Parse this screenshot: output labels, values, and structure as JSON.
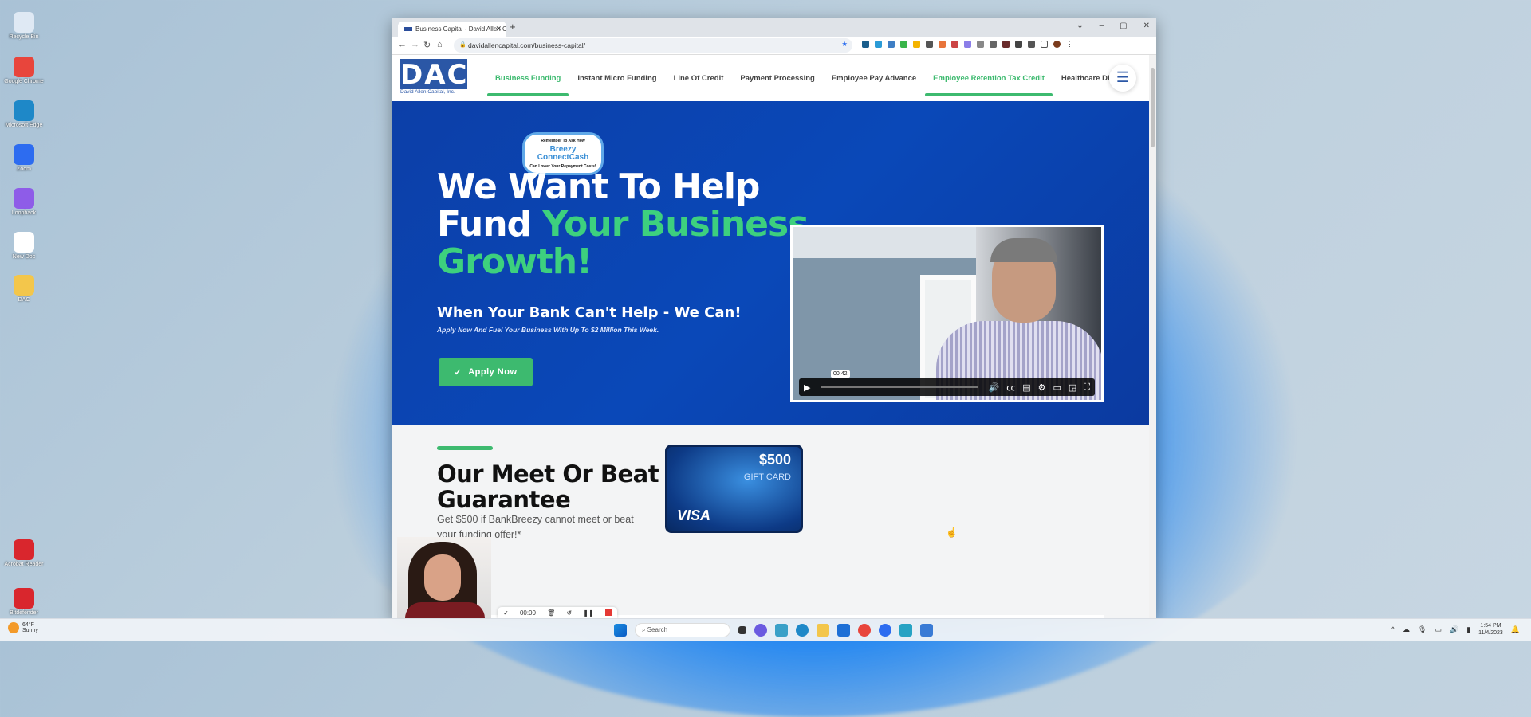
{
  "desktop": {
    "icons": [
      {
        "label": "Recycle Bin",
        "color": "#dfe9f4"
      },
      {
        "label": "Google Chrome",
        "color": "#e8453c"
      },
      {
        "label": "Microsoft Edge",
        "color": "#1e88c8"
      },
      {
        "label": "Zoom",
        "color": "#2d6cf0"
      },
      {
        "label": "Loopback",
        "color": "#8e5ce8"
      },
      {
        "label": "New Doc",
        "color": "#ffffff"
      },
      {
        "label": "DAC",
        "color": "#f3c64b"
      },
      {
        "label": "Acrobat Reader",
        "color": "#d9262d"
      },
      {
        "label": "Bitdefender",
        "color": "#d9262d"
      }
    ]
  },
  "browser": {
    "tab_title": "Business Capital - David Allen C",
    "new_tab": "+",
    "window_controls": [
      "⌄",
      "–",
      "▢",
      "✕"
    ],
    "url": "davidallencapital.com/business-capital/"
  },
  "site": {
    "logo_text": "DAC",
    "logo_sub": "David Allen Capital, Inc.",
    "nav": [
      {
        "label": "Business Funding",
        "active": true
      },
      {
        "label": "Instant Micro Funding",
        "active": false
      },
      {
        "label": "Line Of Credit",
        "active": false
      },
      {
        "label": "Payment Processing",
        "active": false
      },
      {
        "label": "Employee Pay Advance",
        "active": false
      },
      {
        "label": "Employee Retention Tax Credit",
        "active": true
      },
      {
        "label": "Healthcare Division",
        "active": false
      }
    ],
    "hero": {
      "bubble_top": "Remember To Ask How",
      "bubble_brand": "Breezy ConnectCash",
      "bubble_bottom": "Can Lower Your Repayment Costs!",
      "headline_white_1": "We Want To Help",
      "headline_white_2": "Fund ",
      "headline_green_1": "Your Business",
      "headline_green_2": "Growth!",
      "subheadline": "When Your Bank Can't Help - We Can!",
      "tagline": "Apply Now And Fuel Your Business With Up To $2 Million This Week.",
      "apply_label": "Apply Now",
      "video_time": "00:42"
    },
    "guarantee": {
      "heading_1": "Our Meet Or Beat",
      "heading_2": "Guarantee",
      "text": "Get $500 if BankBreezy cannot meet or beat your funding offer!*",
      "gift_amount": "$500",
      "gift_label": "GIFT CARD",
      "gift_brand": "VISA"
    }
  },
  "recorder": {
    "time": "00:00"
  },
  "taskbar": {
    "weather_temp": "64°F",
    "weather_desc": "Sunny",
    "search_placeholder": "Search",
    "time": "1:54 PM",
    "date": "11/4/2023"
  },
  "colors": {
    "brand_blue": "#2b57a6",
    "accent_green": "#3dba6f",
    "hero_blue": "#0c3fa8"
  }
}
